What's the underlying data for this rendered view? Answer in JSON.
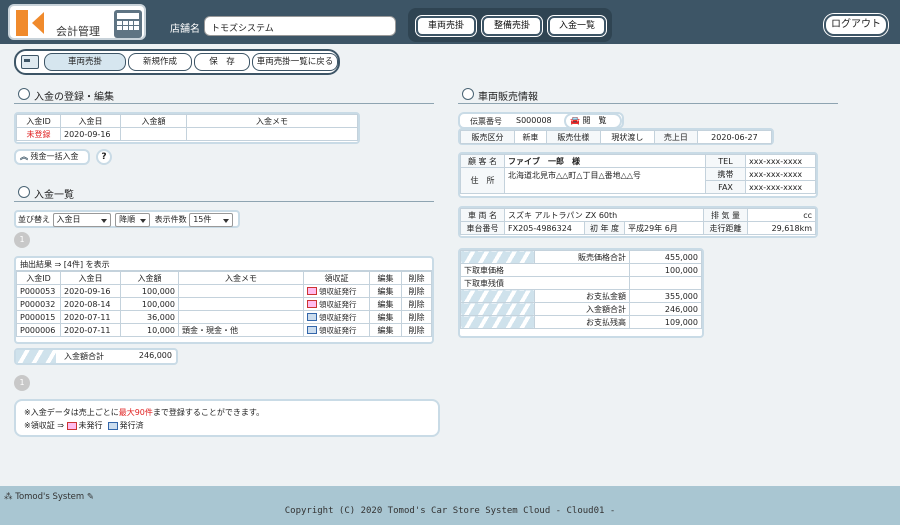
{
  "header": {
    "app_title": "会計管理",
    "store_label": "店舗名",
    "store_value": "トモズシステム",
    "nav": [
      "車両売掛",
      "整備売掛",
      "入金一覧"
    ],
    "logout": "ログアウト"
  },
  "toolbar": {
    "items": [
      "車両売掛",
      "新規作成",
      "保　存",
      "車両売掛一覧に戻る"
    ]
  },
  "payment_edit": {
    "title": "入金の登録・編集",
    "headers": [
      "入金ID",
      "入金日",
      "入金額",
      "入金メモ"
    ],
    "row": {
      "id": "未登録",
      "date": "2020-09-16",
      "amount": "",
      "memo": ""
    },
    "bulk_button": "残金一括入金",
    "help_button": "?"
  },
  "payment_list": {
    "title": "入金一覧",
    "sort_label": "並び替え",
    "sort_field": "入金日",
    "sort_order": "降順",
    "count_label": "表示件数",
    "count_value": "15件",
    "page": "1",
    "result_text": "抽出結果 ⇒ [4件] を表示",
    "headers": [
      "入金ID",
      "入金日",
      "入金額",
      "入金メモ",
      "領収証",
      "編集",
      "削除"
    ],
    "rows": [
      {
        "id": "P000053",
        "date": "2020-09-16",
        "amount": "100,000",
        "memo": "",
        "receipt": "領収証発行",
        "edit": "編集",
        "del": "削除"
      },
      {
        "id": "P000032",
        "date": "2020-08-14",
        "amount": "100,000",
        "memo": "",
        "receipt": "領収証発行",
        "edit": "編集",
        "del": "削除"
      },
      {
        "id": "P000015",
        "date": "2020-07-11",
        "amount": "36,000",
        "memo": "",
        "receipt": "領収証発行",
        "edit": "編集",
        "del": "削除"
      },
      {
        "id": "P000006",
        "date": "2020-07-11",
        "amount": "10,000",
        "memo": "頭金・現金・他",
        "receipt": "領収証発行",
        "edit": "編集",
        "del": "削除"
      }
    ],
    "total_label": "入金額合計",
    "total_value": "246,000",
    "page_bottom": "1"
  },
  "notes": {
    "line1_a": "※入金データは売上ごとに",
    "line1_red": "最大90件",
    "line1_b": "まで登録することができます。",
    "line2_a": "※領収証 ⇒",
    "unissued": "未発行",
    "issued": "発行済"
  },
  "vehicle": {
    "title": "車両販売情報",
    "slip_label": "伝票番号",
    "slip_value": "S000008",
    "view_button": "閲　覧",
    "sale_type_label": "販売区分",
    "sale_type_value": "新車",
    "spec_label": "販売仕様",
    "spec_value": "現状渡し",
    "sale_date_label": "売上日",
    "sale_date_value": "2020-06-27",
    "customer_label": "顧 客 名",
    "customer_value": "ファイブ　一郎　様",
    "address_label": "住　所",
    "address_value": "北海道北見市△△町△丁目△番地△△号",
    "tel_label": "TEL",
    "tel_value": "xxx-xxx-xxxx",
    "mobile_label": "携帯",
    "mobile_value": "xxx-xxx-xxxx",
    "fax_label": "FAX",
    "fax_value": "xxx-xxx-xxxx",
    "car_label": "車 両 名",
    "car_value": "スズキ アルトラパン ZX 60th",
    "displacement_label": "排 気 量",
    "displacement_value": "cc",
    "chassis_label": "車台番号",
    "chassis_value": "FX205-4986324",
    "year_label": "初 年 度",
    "year_value": "平成29年 6月",
    "mileage_label": "走行距離",
    "mileage_value": "29,618km",
    "summary": [
      {
        "label": "販売価格合計",
        "value": "455,000"
      },
      {
        "label": "下取車価格",
        "value": "100,000"
      },
      {
        "label": "下取車残債",
        "value": ""
      },
      {
        "label": "お支払金額",
        "value": "355,000"
      },
      {
        "label": "入金額合計",
        "value": "246,000"
      },
      {
        "label": "お支払残高",
        "value": "109,000"
      }
    ]
  },
  "footer": {
    "brand": "Tomod's System",
    "copyright": "Copyright (C) 2020 Tomod's Car Store System Cloud - Cloud01 -"
  }
}
